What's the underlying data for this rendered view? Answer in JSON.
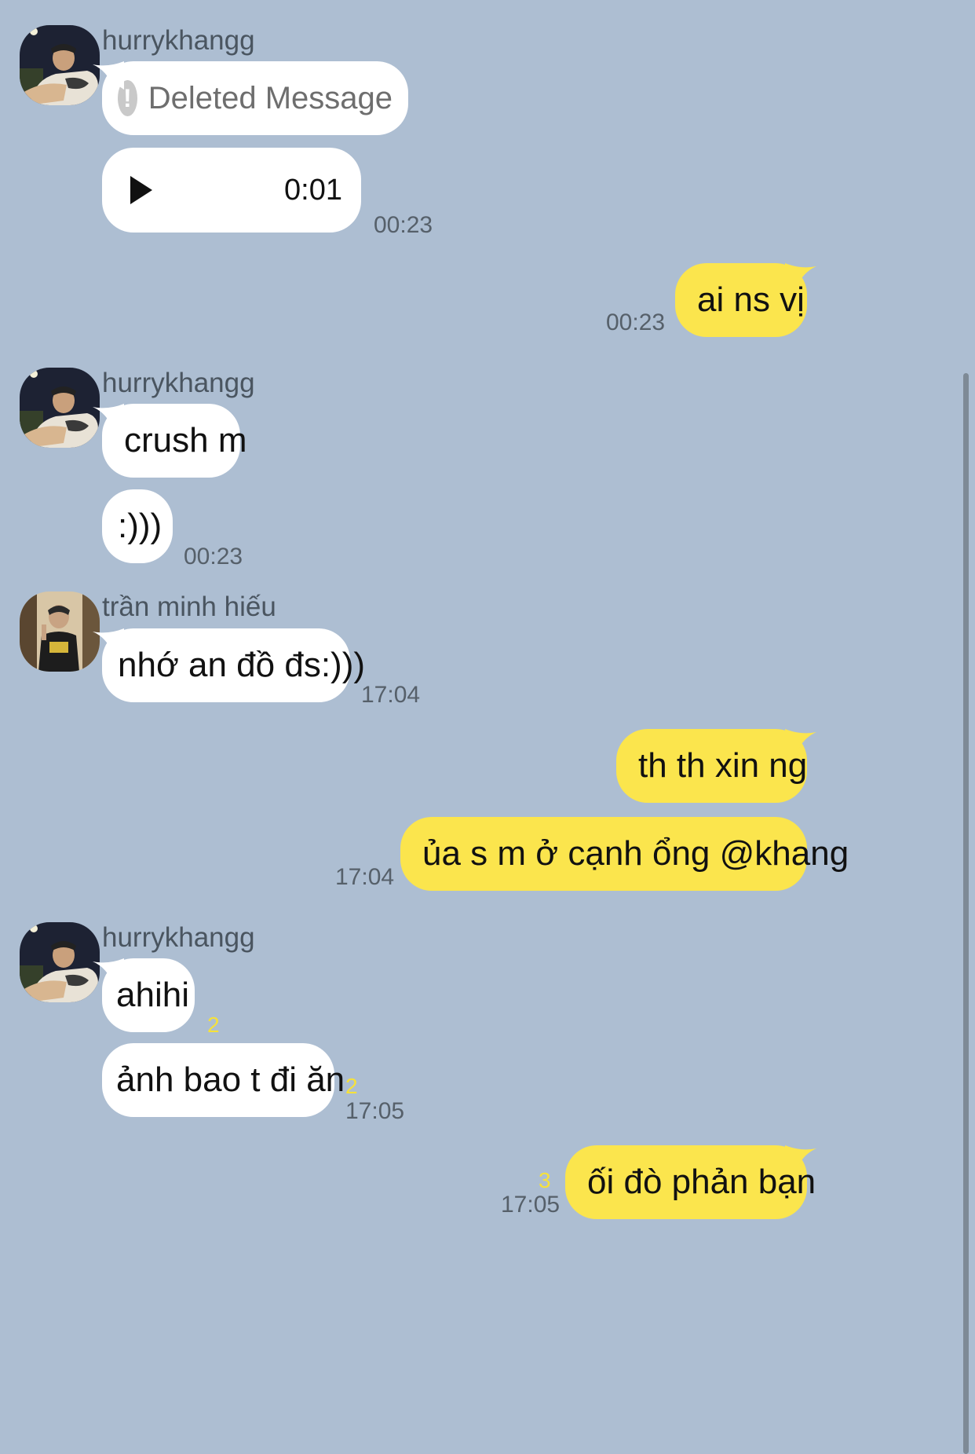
{
  "chat": {
    "groups": [
      {
        "sender": "hurrykhangg",
        "avatar": "hurrykhangg-avatar",
        "messages": [
          {
            "type": "deleted",
            "text": "Deleted Message",
            "icon": "exclamation-icon"
          },
          {
            "type": "voice",
            "duration": "0:01",
            "icon": "play-icon",
            "time": "00:23"
          }
        ]
      },
      {
        "sender": "me",
        "messages": [
          {
            "type": "text",
            "text": "ai ns vị",
            "time": "00:23"
          }
        ]
      },
      {
        "sender": "hurrykhangg",
        "avatar": "hurrykhangg-avatar",
        "messages": [
          {
            "type": "text",
            "text": "crush m"
          },
          {
            "type": "text",
            "text": ":)))",
            "time": "00:23"
          }
        ]
      },
      {
        "sender": "trần minh hiếu",
        "avatar": "tran-minh-hieu-avatar",
        "messages": [
          {
            "type": "text",
            "text": "nhớ an đồ đs:)))",
            "time": "17:04"
          }
        ]
      },
      {
        "sender": "me",
        "messages": [
          {
            "type": "text",
            "text": "th th xin ng"
          },
          {
            "type": "text",
            "text": "ủa s m ở cạnh ổng @khang",
            "time": "17:04"
          }
        ]
      },
      {
        "sender": "hurrykhangg",
        "avatar": "hurrykhangg-avatar",
        "messages": [
          {
            "type": "text",
            "text": "ahihi",
            "unread": "2"
          },
          {
            "type": "text",
            "text": "ảnh bao t đi ăn",
            "unread": "2",
            "time": "17:05"
          }
        ]
      },
      {
        "sender": "me",
        "messages": [
          {
            "type": "text",
            "text": "ối đò phản bạn",
            "unread": "3",
            "time": "17:05"
          }
        ]
      }
    ]
  },
  "colors": {
    "background": "#adbed2",
    "incoming_bubble": "#ffffff",
    "outgoing_bubble": "#fbe54d",
    "unread_count": "#f6e13a"
  }
}
